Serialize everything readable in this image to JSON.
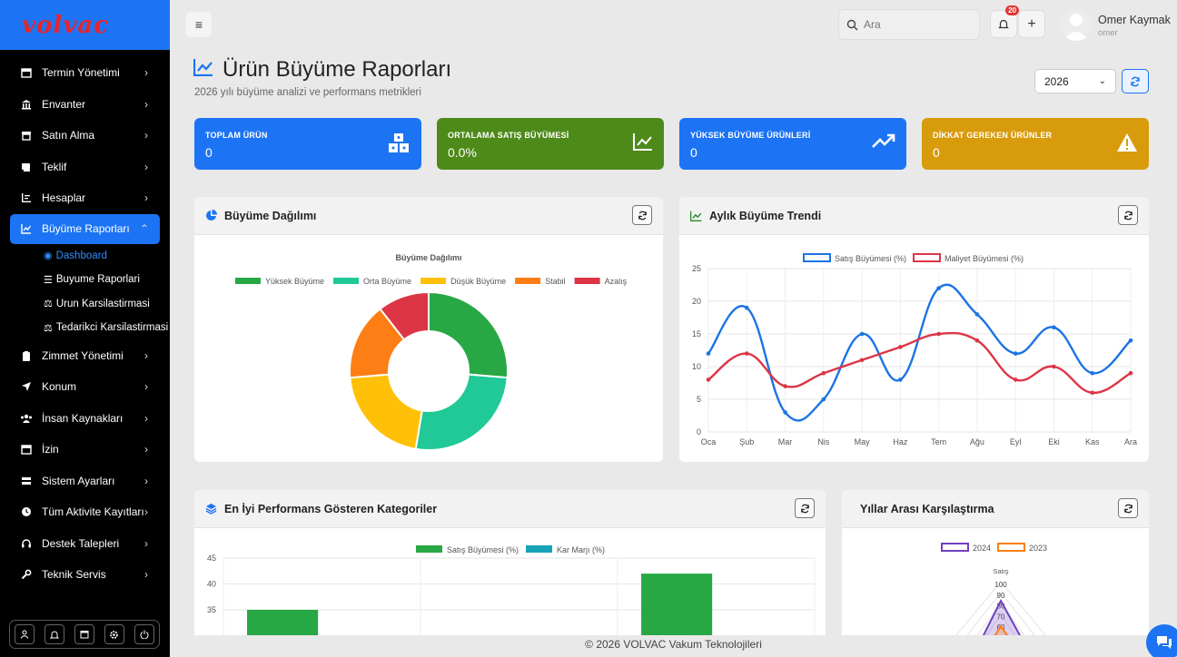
{
  "brand": {
    "logo": "volvac",
    "logo_color": "#e8242c",
    "accent": "#1c74f4"
  },
  "sidebar": {
    "items": [
      {
        "label": "Termin Yönetimi",
        "icon": "calendar-icon"
      },
      {
        "label": "Envanter",
        "icon": "bank-icon"
      },
      {
        "label": "Satın Alma",
        "icon": "store-icon"
      },
      {
        "label": "Teklif",
        "icon": "receipt-icon"
      },
      {
        "label": "Hesaplar",
        "icon": "list-icon"
      },
      {
        "label": "Büyüme Raporları",
        "icon": "chart-line-icon"
      },
      {
        "label": "Zimmet Yönetimi",
        "icon": "clipboard-icon"
      },
      {
        "label": "Konum",
        "icon": "location-arrow-icon"
      },
      {
        "label": "İnsan Kaynakları",
        "icon": "users-icon"
      },
      {
        "label": "İzin",
        "icon": "calendar-icon"
      },
      {
        "label": "Sistem Ayarları",
        "icon": "server-icon"
      },
      {
        "label": "Tüm Aktivite Kayıtları",
        "icon": "clock-icon"
      },
      {
        "label": "Destek Talepleri",
        "icon": "headset-icon"
      },
      {
        "label": "Teknik Servis",
        "icon": "wrench-icon"
      }
    ],
    "subitems": [
      {
        "label": "Dashboard",
        "icon": "dashboard-icon"
      },
      {
        "label": "Buyume Raporlari",
        "icon": "list-icon"
      },
      {
        "label": "Urun Karsilastirmasi",
        "icon": "scale-icon"
      },
      {
        "label": "Tedarikci Karsilastirmasi",
        "icon": "scale-icon"
      }
    ]
  },
  "topbar": {
    "search_placeholder": "Ara",
    "notification_count": "20",
    "user_name": "Omer Kaymak",
    "user_sub": "omer"
  },
  "page": {
    "title": "Ürün Büyüme Raporları",
    "subtitle": "2026 yılı büyüme analizi ve performans metrikleri",
    "year": "2026"
  },
  "kpis": [
    {
      "label": "TOPLAM ÜRÜN",
      "value": "0",
      "color": "#1c74f4",
      "icon": "cubes-icon"
    },
    {
      "label": "ORTALAMA SATIŞ BÜYÜMESİ",
      "value": "0.0%",
      "color": "#4e8a1a",
      "icon": "chart-line-icon"
    },
    {
      "label": "YÜKSEK BÜYÜME ÜRÜNLERİ",
      "value": "0",
      "color": "#1c74f4",
      "icon": "trend-up-icon"
    },
    {
      "label": "DİKKAT GEREKEN ÜRÜNLER",
      "value": "0",
      "color": "#d89b0c",
      "icon": "warning-icon"
    }
  ],
  "cards": {
    "growth_distribution": "Büyüme Dağılımı",
    "monthly_trend": "Aylık Büyüme Trendi",
    "top_categories": "En İyi Performans Gösteren Kategoriler",
    "year_comparison": "Yıllar Arası Karşılaştırma"
  },
  "footer": "© 2026 VOLVAC Vakum Teknolojileri",
  "chart_data": [
    {
      "type": "pie",
      "title": "Büyüme Dağılımı",
      "categories": [
        "Yüksek Büyüme",
        "Orta Büyüme",
        "Düşük Büyüme",
        "Stabil",
        "Azalış"
      ],
      "values": [
        25,
        25,
        20,
        15,
        10
      ],
      "colors": [
        "#28a745",
        "#20c997",
        "#ffc107",
        "#fd7e14",
        "#dc3545"
      ],
      "legend": "top"
    },
    {
      "type": "line",
      "categories": [
        "Oca",
        "Şub",
        "Mar",
        "Nis",
        "May",
        "Haz",
        "Tem",
        "Ağu",
        "Eyl",
        "Eki",
        "Kas",
        "Ara"
      ],
      "series": [
        {
          "name": "Satış Büyümesi (%)",
          "color": "#1c74e4",
          "values": [
            12,
            19,
            3,
            5,
            15,
            8,
            22,
            18,
            12,
            16,
            9,
            14
          ]
        },
        {
          "name": "Maliyet Büyümesi (%)",
          "color": "#dc3545",
          "values": [
            8,
            12,
            7,
            9,
            11,
            13,
            15,
            14,
            8,
            10,
            6,
            9
          ]
        }
      ],
      "yticks": [
        "0",
        "5",
        "10",
        "15",
        "20",
        "25"
      ],
      "ylim": [
        0,
        25
      ],
      "grid": true,
      "legend": "top"
    },
    {
      "type": "bar",
      "categories": [
        "",
        "",
        ""
      ],
      "series": [
        {
          "name": "Satış Büyümesi (%)",
          "color": "#28a745",
          "values": [
            35,
            null,
            42
          ]
        },
        {
          "name": "Kar Marjı (%)",
          "color": "#17a2b8",
          "values": [
            null,
            null,
            null
          ]
        }
      ],
      "yticks": [
        "35",
        "40",
        "45"
      ],
      "legend": "top"
    },
    {
      "type": "radar",
      "axis_label": "Satış",
      "series": [
        {
          "name": "2024",
          "color": "#6f42c1"
        },
        {
          "name": "2023",
          "color": "#fd7e14"
        }
      ],
      "ticks": [
        "100",
        "90",
        "80",
        "70",
        "60"
      ]
    }
  ]
}
